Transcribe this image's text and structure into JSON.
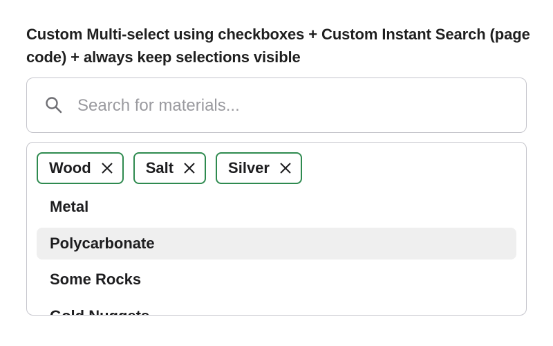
{
  "heading": "Custom Multi-select using checkboxes + Custom Instant Search (page code) + always keep selections visible",
  "search": {
    "icon": "search-icon",
    "placeholder": "Search for materials...",
    "value": ""
  },
  "selected_chips": [
    {
      "label": "Wood",
      "remove_icon": "close-icon"
    },
    {
      "label": "Salt",
      "remove_icon": "close-icon"
    },
    {
      "label": "Silver",
      "remove_icon": "close-icon"
    }
  ],
  "options": [
    {
      "label": "Metal",
      "highlighted": false
    },
    {
      "label": "Polycarbonate",
      "highlighted": true
    },
    {
      "label": "Some Rocks",
      "highlighted": false
    },
    {
      "label": "Gold Nuggets",
      "highlighted": false
    }
  ],
  "colors": {
    "chip_border": "#2e8a4f",
    "hover_bg": "#efefef",
    "border": "#c5c5cc",
    "placeholder": "#9a9a9f"
  }
}
